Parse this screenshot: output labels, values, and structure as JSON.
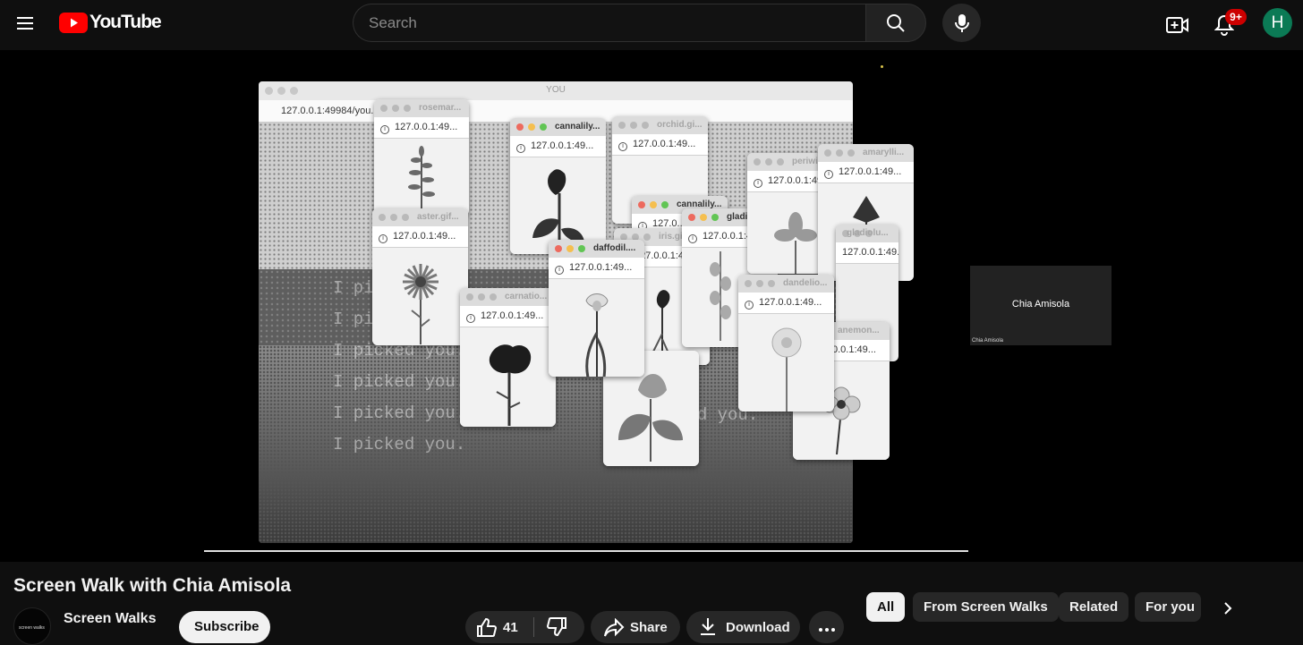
{
  "header": {
    "logo_text": "YouTube",
    "search_placeholder": "Search",
    "notifications_badge": "9+",
    "avatar_letter": "H"
  },
  "player": {
    "screen_window_title": "YOU",
    "screen_url": "127.0.0.1:49984/you...",
    "poem_lines": [
      "I picked you.",
      "I picked you.",
      "I picked you.",
      "I picked you.",
      "I picked you.",
      "I picked you.",
      "I picked you."
    ],
    "windows": [
      {
        "title": "rosemar...",
        "url": "127.0.0.1:49..."
      },
      {
        "title": "aster.gif...",
        "url": "127.0.0.1:49..."
      },
      {
        "title": "cannalily...",
        "url": "127.0.0.1:49..."
      },
      {
        "title": "orchid.gi...",
        "url": "127.0.0.1:49..."
      },
      {
        "title": "carnatio...",
        "url": "127.0.0.1:49..."
      },
      {
        "title": "cannalily...",
        "url": "127.0..."
      },
      {
        "title": "iris.gif (...",
        "url": "127.0.0.1:49..."
      },
      {
        "title": "gladiolu...",
        "url": "127.0.0.1:49..."
      },
      {
        "title": "daffodil....",
        "url": "127.0.0.1:49..."
      },
      {
        "title": "periwink...",
        "url": "127.0.0.1:49..."
      },
      {
        "title": "amarylli...",
        "url": "127.0.0.1:49..."
      },
      {
        "title": "gladiolu...",
        "url": "127.0.0.1:49..."
      },
      {
        "title": "dandelio...",
        "url": "127.0.0.1:49..."
      },
      {
        "title": "anemon...",
        "url": "0.0.1:49..."
      }
    ],
    "pip_name": "Chia Amisola",
    "pip_label": "Chia Amisola",
    "progress": 1.0
  },
  "video": {
    "title": "Screen Walk with Chia Amisola",
    "channel_avatar_text": "screen walks",
    "channel_name": "Screen Walks",
    "subscribe_label": "Subscribe",
    "like_count": "41",
    "share_label": "Share",
    "download_label": "Download"
  },
  "chips": [
    {
      "label": "All",
      "selected": true
    },
    {
      "label": "From Screen Walks",
      "selected": false
    },
    {
      "label": "Related",
      "selected": false
    },
    {
      "label": "For you",
      "selected": false
    }
  ]
}
